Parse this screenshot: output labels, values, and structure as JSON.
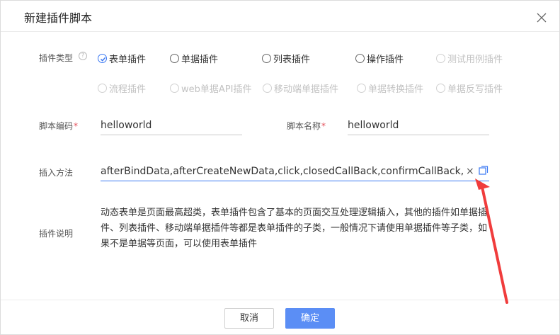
{
  "dialog": {
    "title": "新建插件脚本",
    "close_icon": "close-icon"
  },
  "plugin_type": {
    "label": "插件类型",
    "help_glyph": "?",
    "options": [
      {
        "label": "表单插件",
        "selected": true,
        "disabled": false
      },
      {
        "label": "单据插件",
        "selected": false,
        "disabled": false
      },
      {
        "label": "列表插件",
        "selected": false,
        "disabled": false
      },
      {
        "label": "操作插件",
        "selected": false,
        "disabled": false
      },
      {
        "label": "测试用例插件",
        "selected": false,
        "disabled": true
      },
      {
        "label": "流程插件",
        "selected": false,
        "disabled": true
      },
      {
        "label": "web单据API插件",
        "selected": false,
        "disabled": true
      },
      {
        "label": "移动端单据插件",
        "selected": false,
        "disabled": true
      },
      {
        "label": "单据转换插件",
        "selected": false,
        "disabled": true
      },
      {
        "label": "单据反写插件",
        "selected": false,
        "disabled": true
      }
    ]
  },
  "script_code": {
    "label": "脚本编码",
    "required_mark": "*",
    "value": "helloworld"
  },
  "script_name": {
    "label": "脚本名称",
    "required_mark": "*",
    "value": "helloworld"
  },
  "insert_method": {
    "label": "插入方法",
    "value": "afterBindData,afterCreateNewData,click,closedCallBack,confirmCallBack,itemC",
    "clear_glyph": "×",
    "copy_icon": "copy-icon"
  },
  "plugin_desc": {
    "label": "插件说明",
    "text": "动态表单是页面最高超类，表单插件包含了基本的页面交互处理逻辑插入，其他的插件如单据插件、列表插件、移动端单据插件等都是表单插件的子类，一般情况下请使用单据插件等子类，如果不是单据等页面，可以使用表单插件"
  },
  "footer": {
    "cancel_label": "取消",
    "ok_label": "确定"
  },
  "colors": {
    "accent": "#3a78f2",
    "primary_button": "#5b8ef5",
    "annotation_arrow": "#f03c3c",
    "required": "#e34d59"
  }
}
